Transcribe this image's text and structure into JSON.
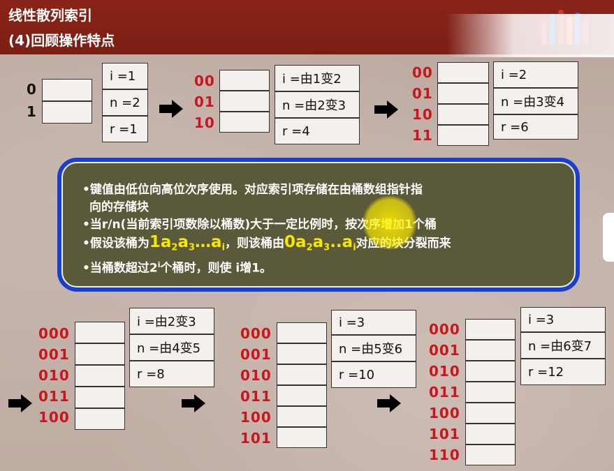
{
  "header": {
    "title": "线性散列索引",
    "subtitle": "(4)回顾操作特点"
  },
  "diagram1": {
    "labels": [
      "0",
      "1"
    ],
    "info": [
      "i =1",
      "n =2",
      "r =1"
    ]
  },
  "diagram2": {
    "labels": [
      "00",
      "01",
      "10"
    ],
    "info": [
      "i =由1变2",
      "n =由2变3",
      "r =4"
    ]
  },
  "diagram3": {
    "labels": [
      "00",
      "01",
      "10",
      "11"
    ],
    "info": [
      "i =2",
      "n =由3变4",
      "r =6"
    ]
  },
  "diagram4": {
    "labels": [
      "000",
      "001",
      "010",
      "011",
      "100"
    ],
    "info": [
      "i =由2变3",
      "n =由4变5",
      "r =8"
    ]
  },
  "diagram5": {
    "labels": [
      "000",
      "001",
      "010",
      "011",
      "100",
      "101"
    ],
    "info": [
      "i =3",
      "n =由5变6",
      "r =10"
    ]
  },
  "diagram6": {
    "labels": [
      "000",
      "001",
      "010",
      "011",
      "100",
      "101",
      "110"
    ],
    "info": [
      "i =3",
      "n =由6变7",
      "r =12"
    ]
  },
  "note": {
    "line1": "•键值由低位向高位次序使用。对应索引项存储在由桶数组指针指",
    "line2": "向的存储块",
    "line3": "•当r/n(当前索引项数除以桶数)大于一定比例时，按次序增加1个桶",
    "line4_a": "•假设该桶为",
    "line4_b": "1a",
    "line4_c": "2",
    "line4_d": "a",
    "line4_e": "3",
    "line4_f": "…a",
    "line4_g": "i",
    "line4_h": "，则该桶由",
    "line4_i": "0a",
    "line4_j": "2",
    "line4_k": "a",
    "line4_l": "3",
    "line4_m": "..a",
    "line4_n": "i",
    "line4_o": "对应的块分裂而来",
    "line5_a": "•当桶数超过2",
    "line5_b": "i",
    "line5_c": "个桶时，则使 i增1。"
  },
  "colors": {
    "header": "#7a1e14",
    "label_red": "#c8161c",
    "note_border": "#1a3fd0",
    "note_fill": "#5a5a3a",
    "highlight_yellow": "#f5e800"
  },
  "icons": [
    "right-arrow-icon"
  ]
}
